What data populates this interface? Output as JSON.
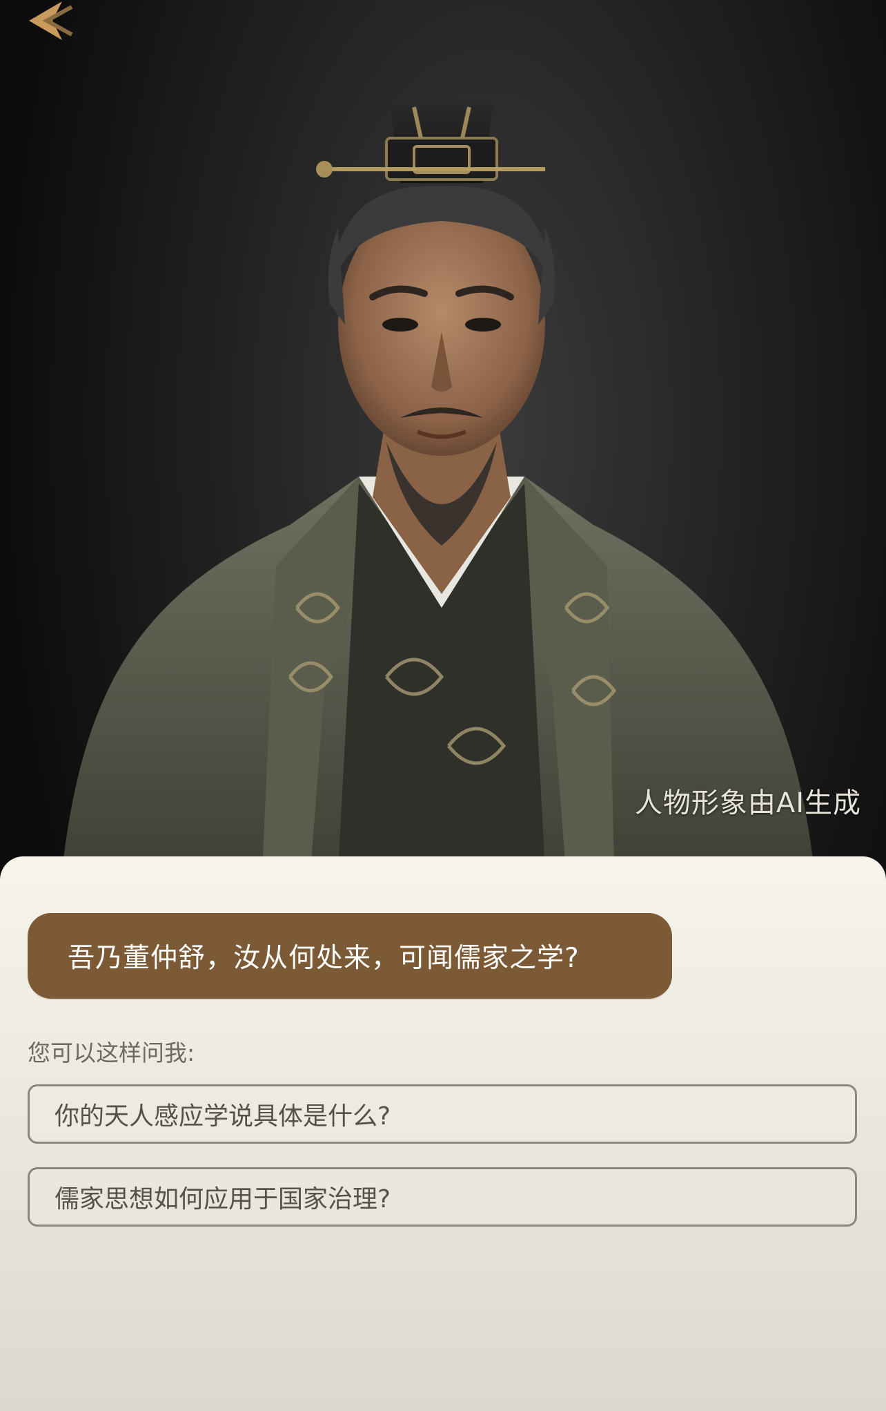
{
  "caption": {
    "ai_generated": "人物形象由AI生成"
  },
  "chat": {
    "greeting": "吾乃董仲舒，汝从何处来，可闻儒家之学?",
    "prompt_hint": "您可以这样问我:",
    "suggestions": [
      "你的天人感应学说具体是什么?",
      "儒家思想如何应用于国家治理?"
    ]
  },
  "colors": {
    "bubble": "#7d5a36",
    "panel": "#f2efe7",
    "accent": "#c89a5b"
  },
  "icons": {
    "back": "back-arrow-icon"
  }
}
